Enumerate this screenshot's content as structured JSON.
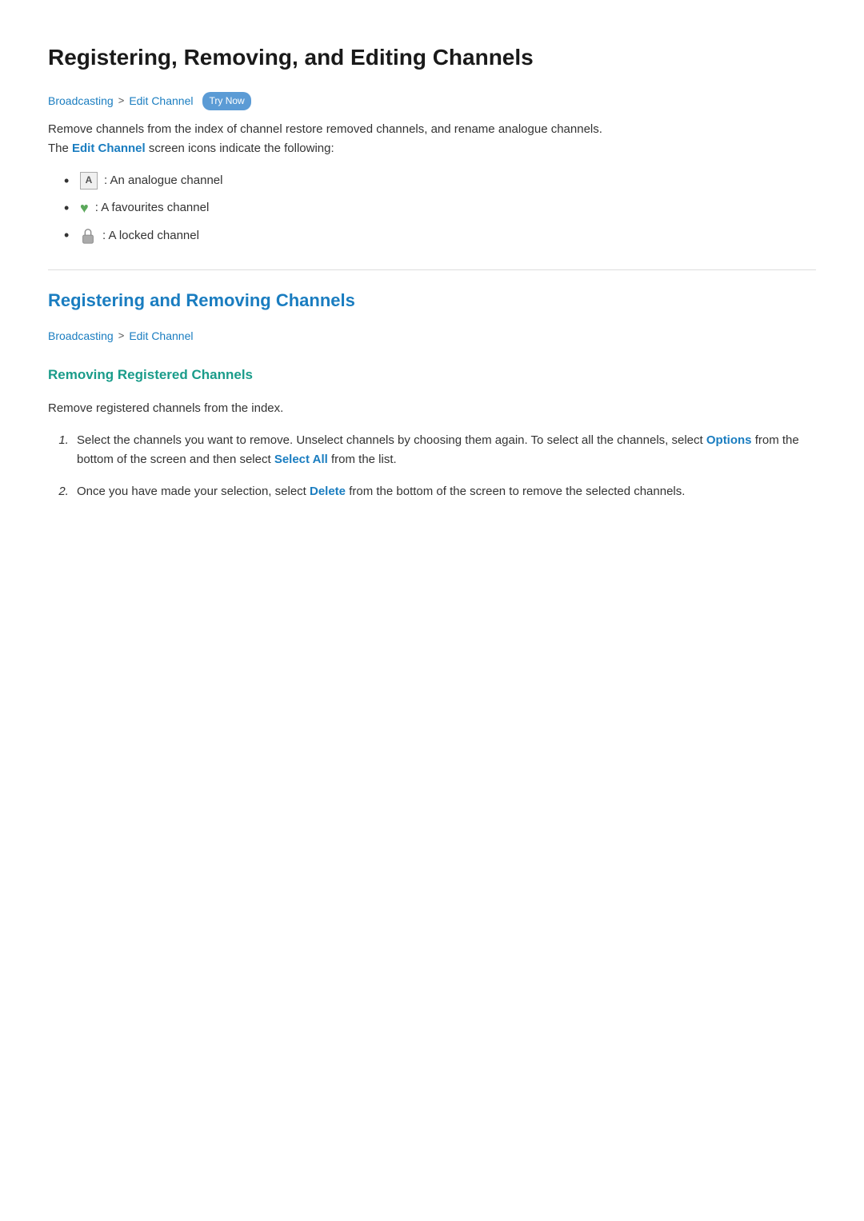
{
  "page": {
    "title": "Registering, Removing, and Editing Channels"
  },
  "breadcrumb1": {
    "link1": "Broadcasting",
    "separator": ">",
    "link2": "Edit Channel",
    "badge": "Try Now"
  },
  "breadcrumb2": {
    "link1": "Broadcasting",
    "separator": ">",
    "link2": "Edit Channel"
  },
  "description": {
    "text1": "Remove channels from the index of channel restore removed channels, and rename analogue channels.",
    "text2": "The ",
    "link": "Edit Channel",
    "text3": " screen icons indicate the following:"
  },
  "bullets": [
    {
      "icon": "A",
      "type": "analogue",
      "text": ": An analogue channel"
    },
    {
      "icon": "heart",
      "type": "favourites",
      "text": ": A favourites channel"
    },
    {
      "icon": "lock",
      "type": "locked",
      "text": ": A locked channel"
    }
  ],
  "section2": {
    "title": "Registering and Removing Channels"
  },
  "subsection1": {
    "title": "Removing Registered Channels",
    "intro": "Remove registered channels from the index.",
    "steps": [
      {
        "number": "1.",
        "text1": "Select the channels you want to remove. Unselect channels by choosing them again. To select all the channels, select ",
        "link1": "Options",
        "text2": " from the bottom of the screen and then select ",
        "link2": "Select All",
        "text3": " from the list."
      },
      {
        "number": "2.",
        "text1": "Once you have made your selection, select ",
        "link1": "Delete",
        "text2": " from the bottom of the screen to remove the selected channels."
      }
    ]
  }
}
